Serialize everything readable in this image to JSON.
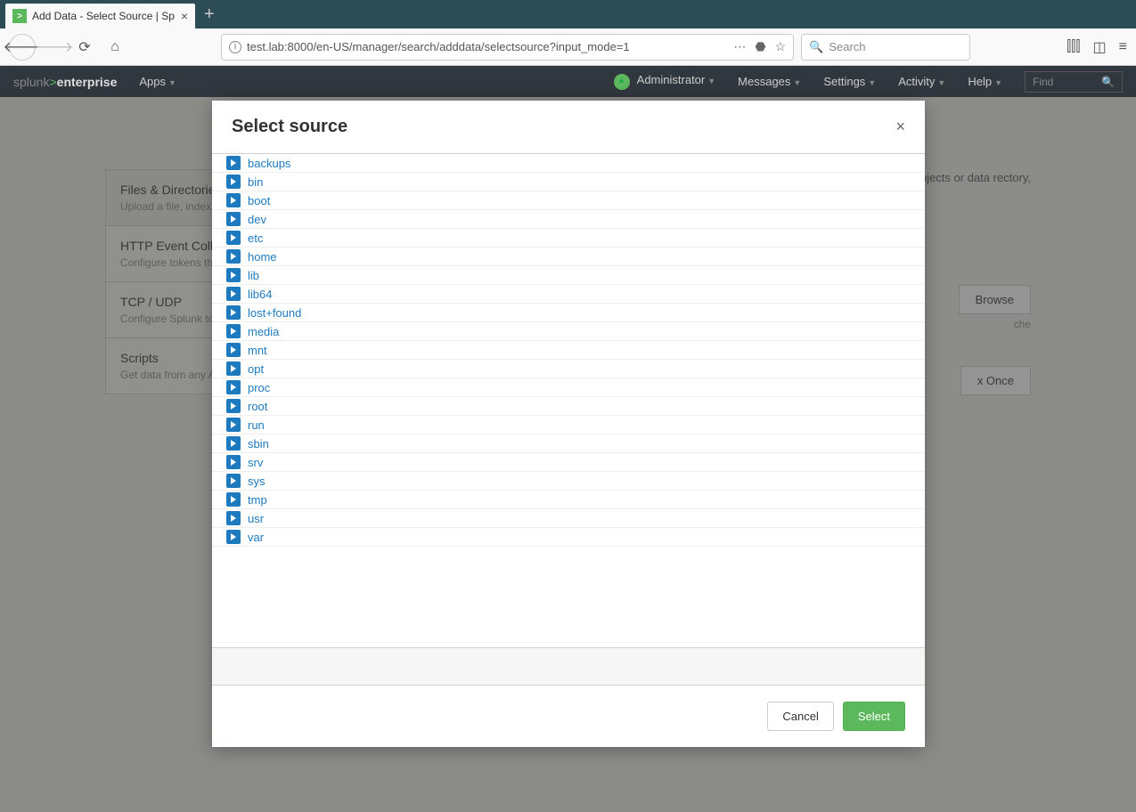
{
  "browser": {
    "tab_title": "Add Data - Select Source | Sp",
    "url": "test.lab:8000/en-US/manager/search/adddata/selectsource?input_mode=1",
    "search_placeholder": "Search"
  },
  "splunk": {
    "logo_a": "splunk",
    "logo_b": "enterprise",
    "apps": "Apps",
    "admin": "Administrator",
    "messages": "Messages",
    "settings": "Settings",
    "activity": "Activity",
    "help": "Help",
    "find": "Find"
  },
  "sidebar": [
    {
      "title": "Files & Directories",
      "desc": "Upload a file, index"
    },
    {
      "title": "HTTP Event Colle",
      "desc": "Configure tokens th HTTPS."
    },
    {
      "title": "TCP / UDP",
      "desc": "Configure Splunk to"
    },
    {
      "title": "Scripts",
      "desc": "Get data from any A"
    }
  ],
  "main": {
    "para": "ects in a to all objects or data rectory,",
    "browse": "Browse",
    "hint": "che",
    "index": "x Once"
  },
  "modal": {
    "title": "Select source",
    "dirs": [
      "backups",
      "bin",
      "boot",
      "dev",
      "etc",
      "home",
      "lib",
      "lib64",
      "lost+found",
      "media",
      "mnt",
      "opt",
      "proc",
      "root",
      "run",
      "sbin",
      "srv",
      "sys",
      "tmp",
      "usr",
      "var"
    ],
    "cancel": "Cancel",
    "select": "Select"
  }
}
